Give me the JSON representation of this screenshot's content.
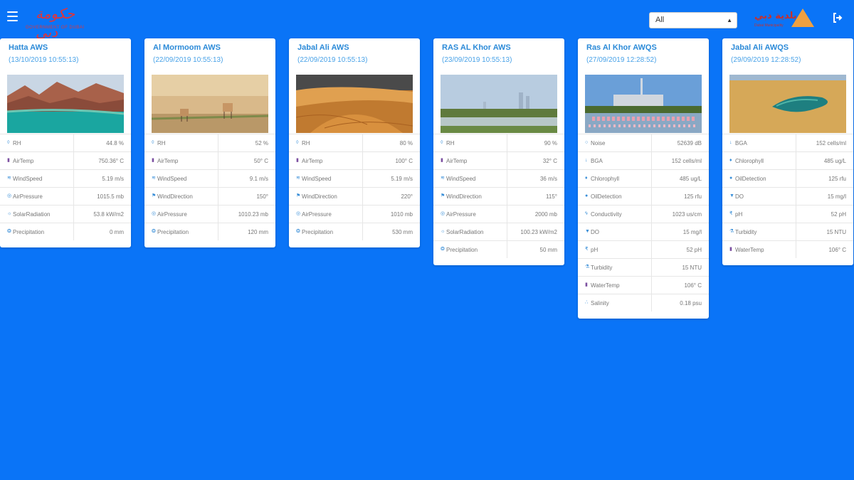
{
  "header": {
    "filter_value": "All",
    "logo_left_script": "حكومة دبي",
    "logo_left_sub": "GOVERNMENT OF DUBAI",
    "logo_right_script": "بلدية دبي",
    "logo_right_sub": "Dubai Municipality"
  },
  "cards": [
    {
      "title": "Hatta AWS",
      "date": "(13/10/2019 10:55:13)",
      "image": "lake-mountains",
      "rows": [
        {
          "icon": "humidity-icon",
          "label": "RH",
          "value": "44.8 %"
        },
        {
          "icon": "thermometer-icon",
          "label": "AirTemp",
          "value": "750.36° C"
        },
        {
          "icon": "wind-icon",
          "label": "WindSpeed",
          "value": "5.19 m/s"
        },
        {
          "icon": "pressure-icon",
          "label": "AirPressure",
          "value": "1015.5 mb"
        },
        {
          "icon": "sun-icon",
          "label": "SolarRadiation",
          "value": "53.8 kW/m2"
        },
        {
          "icon": "rain-icon",
          "label": "Precipitation",
          "value": "0 mm"
        }
      ]
    },
    {
      "title": "Al Mormoom AWS",
      "date": "(22/09/2019 10:55:13)",
      "image": "desert-gazelles",
      "rows": [
        {
          "icon": "humidity-icon",
          "label": "RH",
          "value": "52 %"
        },
        {
          "icon": "thermometer-icon",
          "label": "AirTemp",
          "value": "50° C"
        },
        {
          "icon": "wind-icon",
          "label": "WindSpeed",
          "value": "9.1 m/s"
        },
        {
          "icon": "flag-icon",
          "label": "WindDirection",
          "value": "150°"
        },
        {
          "icon": "pressure-icon",
          "label": "AirPressure",
          "value": "1010.23 mb"
        },
        {
          "icon": "rain-icon",
          "label": "Precipitation",
          "value": "120 mm"
        }
      ]
    },
    {
      "title": "Jabal Ali AWS",
      "date": "(22/09/2019 10:55:13)",
      "image": "sand-dunes",
      "rows": [
        {
          "icon": "humidity-icon",
          "label": "RH",
          "value": "80 %"
        },
        {
          "icon": "thermometer-icon",
          "label": "AirTemp",
          "value": "100° C"
        },
        {
          "icon": "wind-icon",
          "label": "WindSpeed",
          "value": "5.19 m/s"
        },
        {
          "icon": "flag-icon",
          "label": "WindDirection",
          "value": "220°"
        },
        {
          "icon": "pressure-icon",
          "label": "AirPressure",
          "value": "1010 mb"
        },
        {
          "icon": "rain-icon",
          "label": "Precipitation",
          "value": "530 mm"
        }
      ]
    },
    {
      "title": "RAS AL Khor AWS",
      "date": "(23/09/2019 10:55:13)",
      "image": "wetland-skyline",
      "rows": [
        {
          "icon": "humidity-icon",
          "label": "RH",
          "value": "90 %"
        },
        {
          "icon": "thermometer-icon",
          "label": "AirTemp",
          "value": "32° C"
        },
        {
          "icon": "wind-icon",
          "label": "WindSpeed",
          "value": "36 m/s"
        },
        {
          "icon": "flag-icon",
          "label": "WindDirection",
          "value": "115°"
        },
        {
          "icon": "pressure-icon",
          "label": "AirPressure",
          "value": "2000 mb"
        },
        {
          "icon": "sun-icon",
          "label": "SolarRadiation",
          "value": "100.23 kW/m2"
        },
        {
          "icon": "rain-icon",
          "label": "Precipitation",
          "value": "50 mm"
        }
      ]
    },
    {
      "title": "Ras Al Khor AWQS",
      "date": "(27/09/2019 12:28:52)",
      "image": "flamingos-skyline",
      "rows": [
        {
          "icon": "noise-icon",
          "label": "Noise",
          "value": "52639 dB"
        },
        {
          "icon": "arrow-down-icon",
          "label": "BGA",
          "value": "152 cells/ml"
        },
        {
          "icon": "drops-icon",
          "label": "Chlorophyll",
          "value": "485 ug/L"
        },
        {
          "icon": "drop-icon",
          "label": "OilDetection",
          "value": "125 rfu"
        },
        {
          "icon": "bolt-icon",
          "label": "Conductivity",
          "value": "1023 us/cm"
        },
        {
          "icon": "do-icon",
          "label": "DO",
          "value": "15 mg/l"
        },
        {
          "icon": "ph-icon",
          "label": "pH",
          "value": "52 pH"
        },
        {
          "icon": "flask-icon",
          "label": "Turbidity",
          "value": "15 NTU"
        },
        {
          "icon": "thermometer-icon",
          "label": "WaterTemp",
          "value": "106° C"
        },
        {
          "icon": "salt-icon",
          "label": "Salinity",
          "value": "0.18 psu"
        }
      ]
    },
    {
      "title": "Jabal Ali AWQS",
      "date": "(29/09/2019 12:28:52)",
      "image": "coastal-lagoon",
      "rows": [
        {
          "icon": "arrow-down-icon",
          "label": "BGA",
          "value": "152 cells/ml"
        },
        {
          "icon": "drops-icon",
          "label": "Chlorophyll",
          "value": "485 ug/L"
        },
        {
          "icon": "drop-icon",
          "label": "OilDetection",
          "value": "125 rfu"
        },
        {
          "icon": "do-icon",
          "label": "DO",
          "value": "15 mg/l"
        },
        {
          "icon": "ph-icon",
          "label": "pH",
          "value": "52 pH"
        },
        {
          "icon": "flask-icon",
          "label": "Turbidity",
          "value": "15 NTU"
        },
        {
          "icon": "thermometer-icon",
          "label": "WaterTemp",
          "value": "106° C"
        }
      ]
    }
  ]
}
